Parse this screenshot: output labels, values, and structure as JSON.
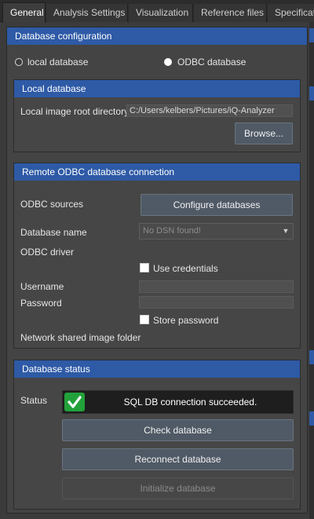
{
  "tabs": [
    {
      "label": "General",
      "active": true
    },
    {
      "label": "Analysis Settings",
      "active": false
    },
    {
      "label": "Visualization",
      "active": false
    },
    {
      "label": "Reference files",
      "active": false
    },
    {
      "label": "Specificat",
      "active": false
    }
  ],
  "db_config": {
    "title": "Database configuration",
    "option_local": "local database",
    "option_odbc": "ODBC database",
    "selected": "odbc"
  },
  "local_db": {
    "title": "Local database",
    "root_label": "Local image root directory",
    "root_value": "C:/Users/kelbers/Pictures/iQ-Analyzer",
    "browse_label": "Browse..."
  },
  "remote_db": {
    "title": "Remote ODBC database connection",
    "sources_label": "ODBC sources",
    "configure_label": "Configure databases",
    "dbname_label": "Database name",
    "dbname_value": "No DSN found!",
    "driver_label": "ODBC driver",
    "use_credentials_label": "Use credentials",
    "username_label": "Username",
    "password_label": "Password",
    "store_password_label": "Store password",
    "shared_folder_label": "Network shared image folder"
  },
  "db_status": {
    "title": "Database status",
    "status_label": "Status",
    "status_message": "SQL DB connection succeeded.",
    "check_label": "Check database",
    "reconnect_label": "Reconnect database",
    "initialize_label": "Initialize database"
  },
  "colors": {
    "header_blue": "#2e5aa6",
    "success_green": "#22a13a"
  }
}
